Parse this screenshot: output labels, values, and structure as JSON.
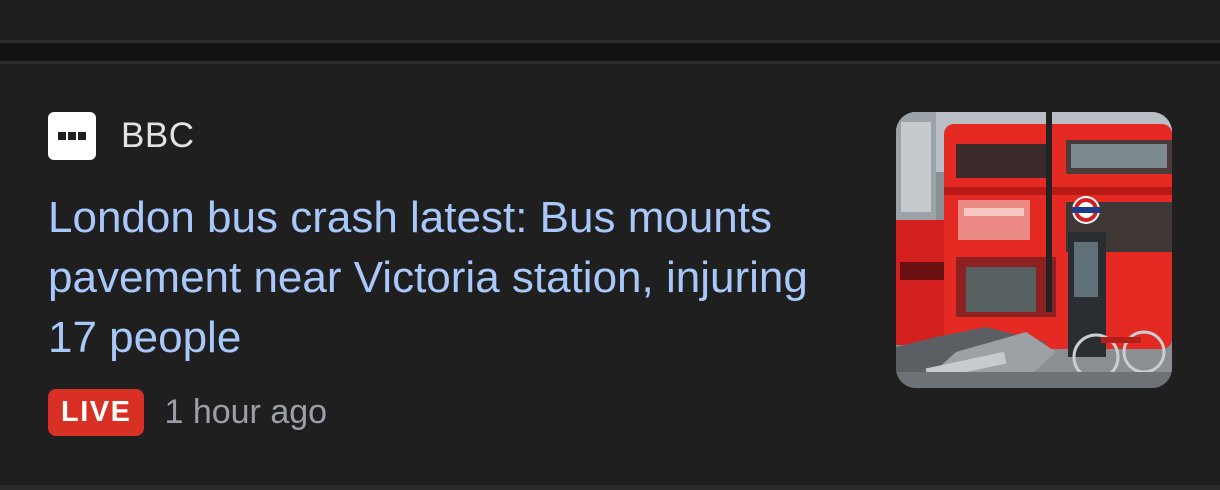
{
  "article": {
    "source": {
      "name": "BBC",
      "logo_icon": "bbc-logo-icon"
    },
    "headline": "London bus crash latest: Bus mounts pavement near Victoria station, injuring 17 people",
    "badge": "LIVE",
    "time_ago": "1 hour ago",
    "thumbnail_icon": "red-double-decker-bus-photo"
  },
  "colors": {
    "background": "#1f1f1f",
    "headline": "#a8c7fa",
    "source_text": "#e3e3e3",
    "meta_text": "#9aa0a6",
    "live_badge": "#d93025"
  }
}
